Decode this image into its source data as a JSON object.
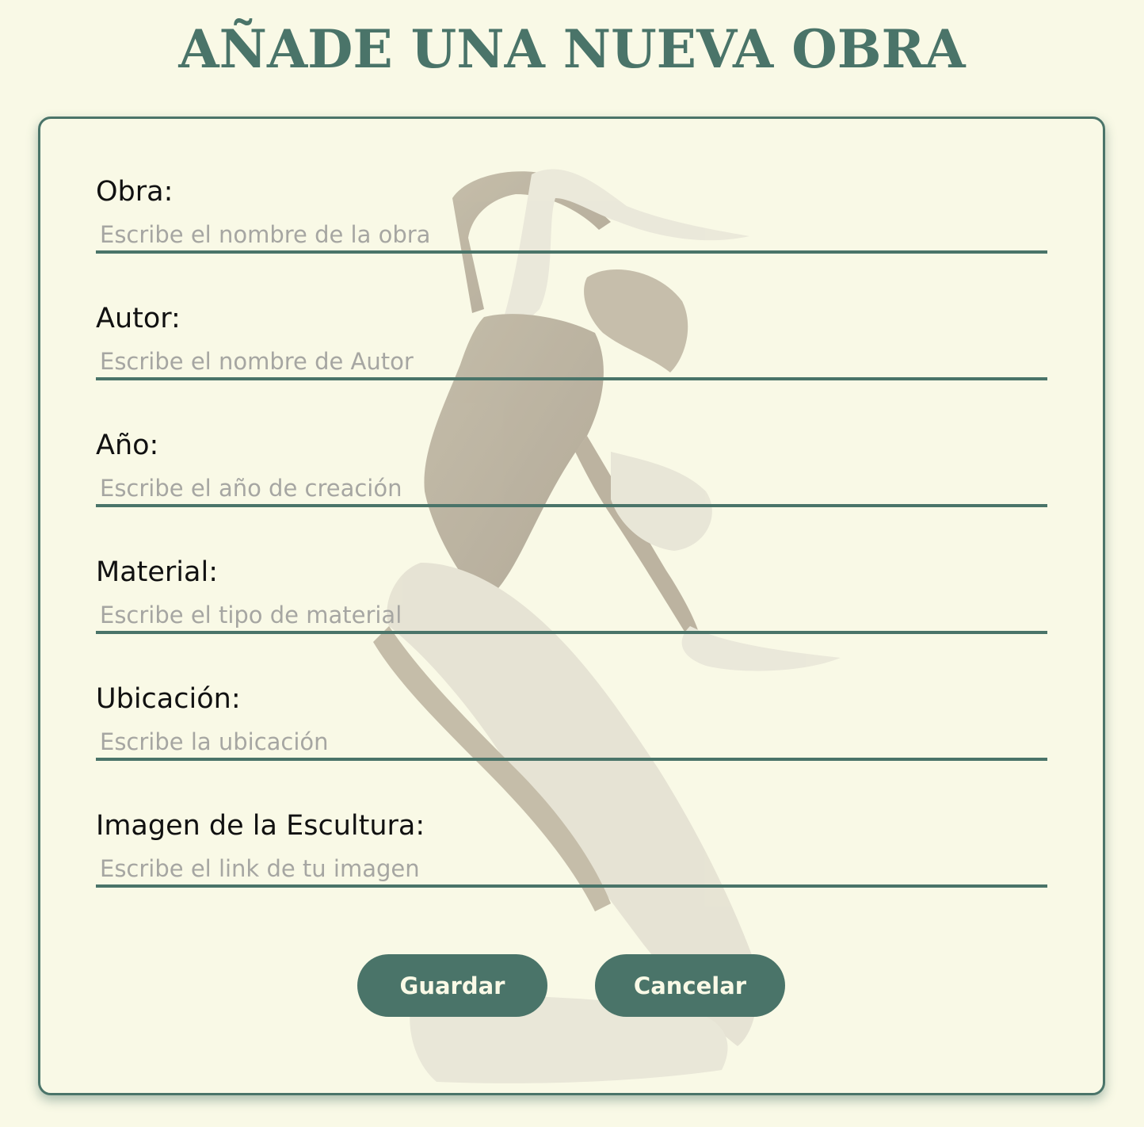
{
  "page": {
    "title": "AÑADE UNA NUEVA OBRA"
  },
  "colors": {
    "background": "#f9f9e6",
    "accent": "#4a7469",
    "placeholder": "#a6a6a2"
  },
  "form": {
    "fields": [
      {
        "label": "Obra:",
        "placeholder": "Escribe el nombre de la obra",
        "value": ""
      },
      {
        "label": "Autor:",
        "placeholder": "Escribe el nombre de Autor",
        "value": ""
      },
      {
        "label": "Año:",
        "placeholder": "Escribe el año de creación",
        "value": ""
      },
      {
        "label": "Material:",
        "placeholder": "Escribe el tipo de material",
        "value": ""
      },
      {
        "label": "Ubicación:",
        "placeholder": "Escribe la ubicación",
        "value": ""
      },
      {
        "label": "Imagen de la Escultura:",
        "placeholder": "Escribe el link de tu imagen",
        "value": ""
      }
    ],
    "buttons": {
      "save": "Guardar",
      "cancel": "Cancelar"
    }
  },
  "background_image": {
    "icon": "dancer-sculpture-watermark"
  }
}
